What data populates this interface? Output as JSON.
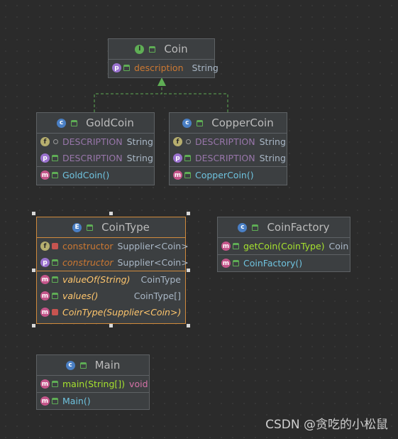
{
  "coin": {
    "title": "Coin",
    "fields": [
      {
        "name": "description",
        "type": "String"
      }
    ]
  },
  "gold": {
    "title": "GoldCoin",
    "fields": [
      {
        "name": "DESCRIPTION",
        "type": "String"
      },
      {
        "name": "DESCRIPTION",
        "type": "String"
      }
    ],
    "methods": [
      {
        "name": "GoldCoin()"
      }
    ]
  },
  "copper": {
    "title": "CopperCoin",
    "fields": [
      {
        "name": "DESCRIPTION",
        "type": "String"
      },
      {
        "name": "DESCRIPTION",
        "type": "String"
      }
    ],
    "methods": [
      {
        "name": "CopperCoin()"
      }
    ]
  },
  "cointype": {
    "title": "CoinType",
    "fields": [
      {
        "name": "constructor",
        "type": "Supplier<Coin>"
      },
      {
        "name": "constructor",
        "type": "Supplier<Coin>"
      }
    ],
    "methods": [
      {
        "name": "valueOf(String)",
        "type": "CoinType"
      },
      {
        "name": "values()",
        "type": "CoinType[]"
      },
      {
        "name": "CoinType(Supplier<Coin>)",
        "type": ""
      }
    ]
  },
  "factory": {
    "title": "CoinFactory",
    "methods": [
      {
        "name": "getCoin(CoinType)",
        "type": "Coin"
      },
      {
        "name": "CoinFactory()"
      }
    ]
  },
  "main": {
    "title": "Main",
    "methods": [
      {
        "name": "main(String[])",
        "type": "void"
      },
      {
        "name": "Main()"
      }
    ]
  },
  "badges": {
    "i": "I",
    "c": "c",
    "e": "E",
    "p": "p",
    "f": "f",
    "m": "m"
  },
  "watermark": "CSDN @贪吃的小松鼠"
}
